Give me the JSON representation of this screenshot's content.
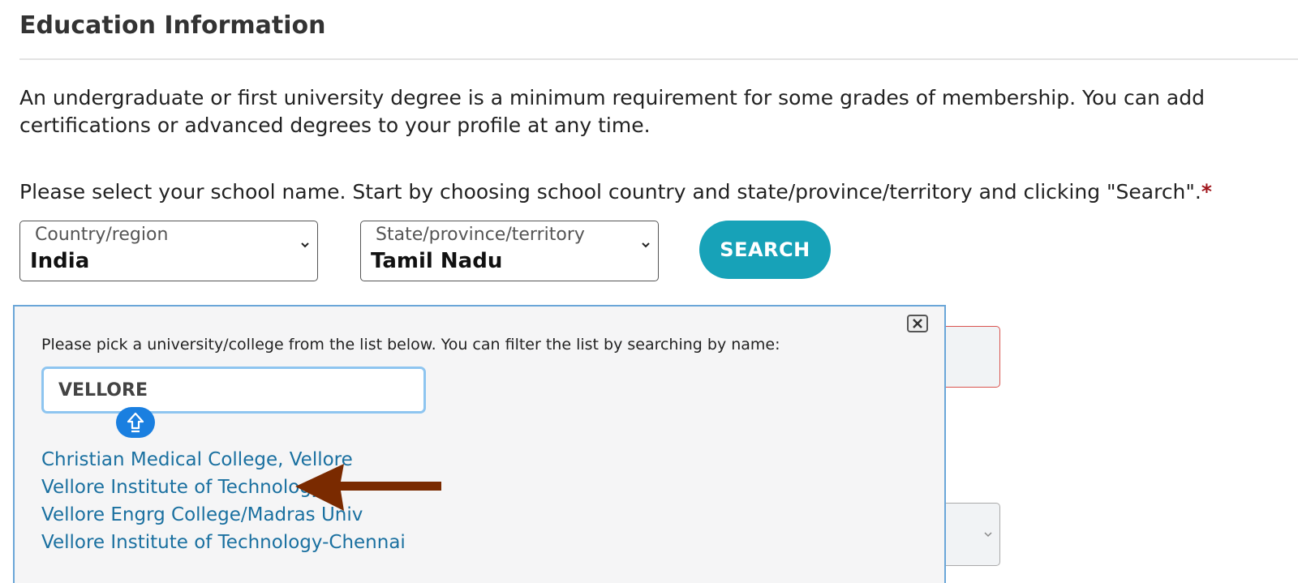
{
  "section": {
    "title": "Education Information",
    "intro": "An undergraduate or first university degree is a minimum requirement for some grades of membership. You can add certifications or advanced degrees to your profile at any time.",
    "instruction": "Please select your school name. Start by choosing school country and state/province/territory and clicking \"Search\".",
    "required_marker": "*"
  },
  "filters": {
    "country": {
      "label": "Country/region",
      "value": "India"
    },
    "state": {
      "label": "State/province/territory",
      "value": "Tamil Nadu"
    },
    "search_label": "SEARCH"
  },
  "popup": {
    "prompt": "Please pick a university/college from the list below. You can filter the list by searching by name:",
    "filter_value": "VELLORE",
    "results": [
      "Christian Medical College, Vellore",
      "Vellore Institute of Technology",
      "Vellore Engrg College/Madras Univ",
      "Vellore Institute of Technology-Chennai"
    ],
    "highlighted_result_index": 1
  },
  "colors": {
    "accent": "#17a2b8",
    "link": "#1a70a0",
    "required": "#a0151b",
    "annotation_arrow": "#7a2a00",
    "popup_border": "#6aa6d8"
  },
  "icons": {
    "popup_close": "close-icon",
    "shift_badge": "shift-arrow-icon",
    "select_caret": "chevron-down-icon",
    "annotation": "arrow-left-icon"
  }
}
